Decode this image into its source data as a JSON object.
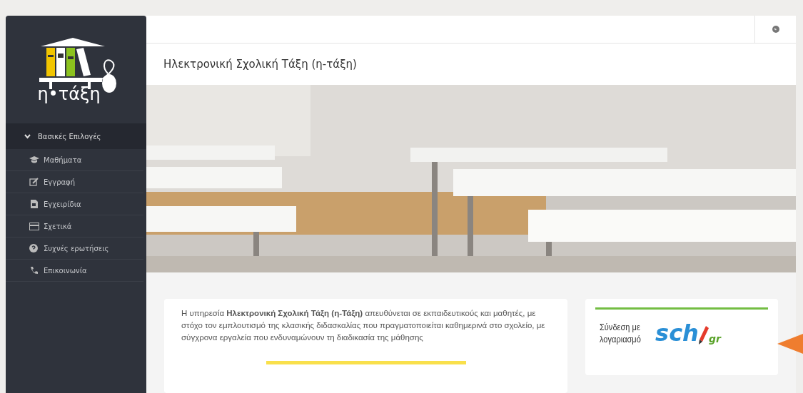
{
  "sidebar": {
    "logo_text": "η•τάξη",
    "section": {
      "label": "Βασικές Επιλογές",
      "expanded": true
    },
    "items": [
      {
        "label": "Μαθήματα",
        "kind": "cap"
      },
      {
        "label": "Εγγραφή",
        "kind": "edit"
      },
      {
        "label": "Εγχειρίδια",
        "kind": "doc"
      },
      {
        "label": "Σχετικά",
        "kind": "card"
      },
      {
        "label": "Συχνές ερωτήσεις",
        "kind": "question"
      },
      {
        "label": "Επικοινωνία",
        "kind": "phone"
      }
    ]
  },
  "header": {
    "title": "Ηλεκτρονική Σχολική Τάξη (η-τάξη)"
  },
  "intro": {
    "text": "Η υπηρεσία **Ηλεκτρονική Σχολική Τάξη (η-Τάξη)** απευθύνεται σε εκπαιδευτικούς και μαθητές, με στόχο τον εμπλουτισμό της κλασικής διδασκαλίας που πραγματοποιείται καθημερινά στο σχολείο, με σύγχρονα εργαλεία που ενδυναμώνουν τη διαδικασία της μάθησης"
  },
  "login": {
    "label_line_1": "Σύνδεση με",
    "label_line_2": "λογαριασμό",
    "logo_main": "sch",
    "logo_suffix": "gr"
  }
}
